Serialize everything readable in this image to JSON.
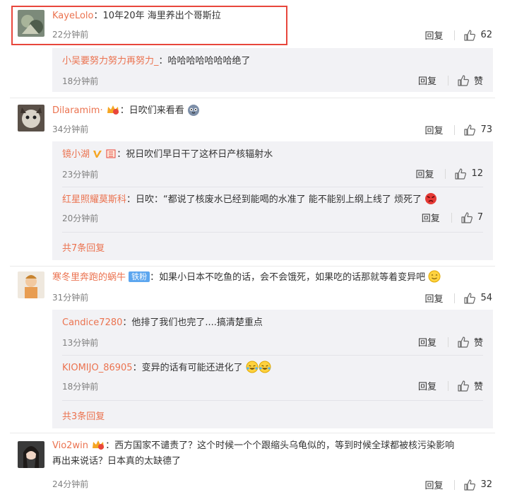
{
  "reply_label": "回复",
  "like_zan": "赞",
  "comments": [
    {
      "user": "KayeLolo",
      "text": "：10年20年 海里养出个哥斯拉",
      "time": "22分钟前",
      "likes": "62",
      "sub": [
        {
          "user": "小吴要努力努力再努力_",
          "text": "：哈哈哈哈哈哈哈绝了",
          "time": "18分钟前",
          "likes": "赞"
        }
      ],
      "more": ""
    },
    {
      "user": "Dilaramim·",
      "text": "：日吹们来看看",
      "time": "34分钟前",
      "likes": "73",
      "sub": [
        {
          "user": "镜小湖",
          "text": "：祝日吹们早日干了这杯日产核辐射水",
          "time": "23分钟前",
          "likes": "12"
        },
        {
          "user": "红星照耀莫斯科",
          "text": "：日吹：“都说了核废水已经到能喝的水准了 能不能别上纲上线了 烦死了",
          "time": "20分钟前",
          "likes": "7"
        }
      ],
      "more": "共7条回复"
    },
    {
      "user": "寒冬里奔跑的蜗牛",
      "badge": "铁粉",
      "text": "：如果小日本不吃鱼的话，会不会饿死，如果吃的话那就等着变异吧",
      "time": "31分钟前",
      "likes": "54",
      "sub": [
        {
          "user": "Candice7280",
          "text": "：他排了我们也完了....搞清楚重点",
          "time": "13分钟前",
          "likes": "赞"
        },
        {
          "user": "KIOMIJO_86905",
          "text": "：变异的话有可能还进化了",
          "time": "18分钟前",
          "likes": "赞"
        }
      ],
      "more": "共3条回复"
    },
    {
      "user": "Vio2win",
      "text": "：西方国家不谴责了？这个时候一个个跟缩头乌龟似的，等到时候全球都被核污染影响",
      "text2": "再出来说话？日本真的太缺德了",
      "time": "24分钟前",
      "likes": "32"
    }
  ]
}
